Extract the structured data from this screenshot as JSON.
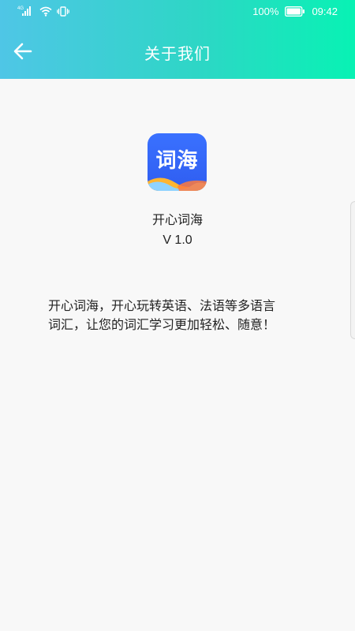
{
  "status_bar": {
    "network_label": "4G",
    "battery_percent": "100%",
    "time": "09:42",
    "icons": [
      "signal-icon",
      "wifi-icon",
      "vibrate-icon",
      "battery-icon"
    ]
  },
  "header": {
    "title": "关于我们",
    "back_icon": "arrow-left-icon",
    "gradient": [
      "#4fc6e6",
      "#08f2b4"
    ]
  },
  "app": {
    "icon_text": "词海",
    "icon_color": "#3a71ff",
    "name": "开心词海",
    "version": "V 1.0"
  },
  "description": {
    "line1": "开心词海，开心玩转英语、法语等多语言",
    "line2": "词汇，让您的词汇学习更加轻松、随意！"
  }
}
